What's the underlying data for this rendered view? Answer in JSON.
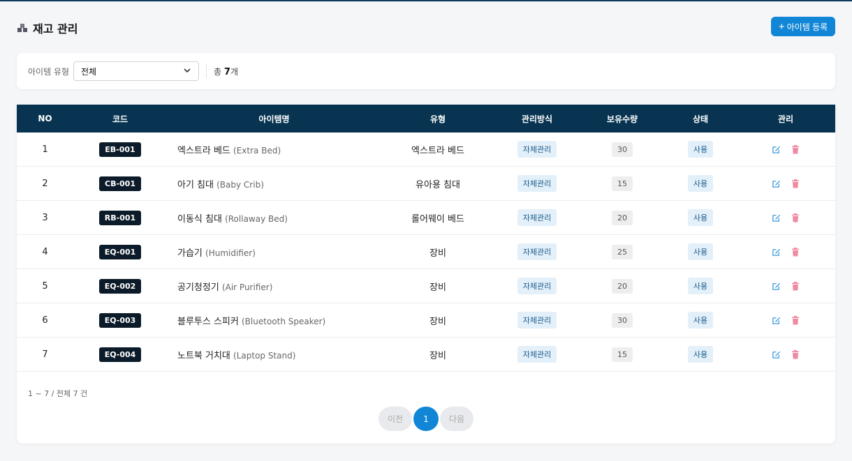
{
  "header": {
    "title": "재고 관리",
    "add_button": "아이템 등록"
  },
  "filter": {
    "label": "아이템 유형",
    "selected": "전체",
    "total_prefix": "총",
    "total_count": "7",
    "total_suffix": "개"
  },
  "table": {
    "columns": [
      "NO",
      "코드",
      "아이템명",
      "유형",
      "관리방식",
      "보유수량",
      "상태",
      "관리"
    ],
    "rows": [
      {
        "no": "1",
        "code": "EB-001",
        "name": "엑스트라 베드",
        "name_en": "(Extra Bed)",
        "type": "엑스트라 베드",
        "method": "자체관리",
        "qty": "30",
        "status": "사용"
      },
      {
        "no": "2",
        "code": "CB-001",
        "name": "아기 침대",
        "name_en": "(Baby Crib)",
        "type": "유아용 침대",
        "method": "자체관리",
        "qty": "15",
        "status": "사용"
      },
      {
        "no": "3",
        "code": "RB-001",
        "name": "이동식 침대",
        "name_en": "(Rollaway Bed)",
        "type": "롤어웨이 베드",
        "method": "자체관리",
        "qty": "20",
        "status": "사용"
      },
      {
        "no": "4",
        "code": "EQ-001",
        "name": "가습기",
        "name_en": "(Humidifier)",
        "type": "장비",
        "method": "자체관리",
        "qty": "25",
        "status": "사용"
      },
      {
        "no": "5",
        "code": "EQ-002",
        "name": "공기청정기",
        "name_en": "(Air Purifier)",
        "type": "장비",
        "method": "자체관리",
        "qty": "20",
        "status": "사용"
      },
      {
        "no": "6",
        "code": "EQ-003",
        "name": "블루투스 스피커",
        "name_en": "(Bluetooth Speaker)",
        "type": "장비",
        "method": "자체관리",
        "qty": "30",
        "status": "사용"
      },
      {
        "no": "7",
        "code": "EQ-004",
        "name": "노트북 거치대",
        "name_en": "(Laptop Stand)",
        "type": "장비",
        "method": "자체관리",
        "qty": "15",
        "status": "사용"
      }
    ]
  },
  "pagination": {
    "summary": "1 ~ 7 / 전체 7 건",
    "prev": "이전",
    "current": "1",
    "next": "다음"
  },
  "colors": {
    "header_bg": "#083452",
    "accent": "#1185d6",
    "edit_icon": "#3a9ad9",
    "delete_icon": "#f08aa0"
  },
  "icons": {
    "title": "boxes-icon",
    "edit": "edit-icon",
    "delete": "trash-icon",
    "select": "chevron-down-icon"
  }
}
